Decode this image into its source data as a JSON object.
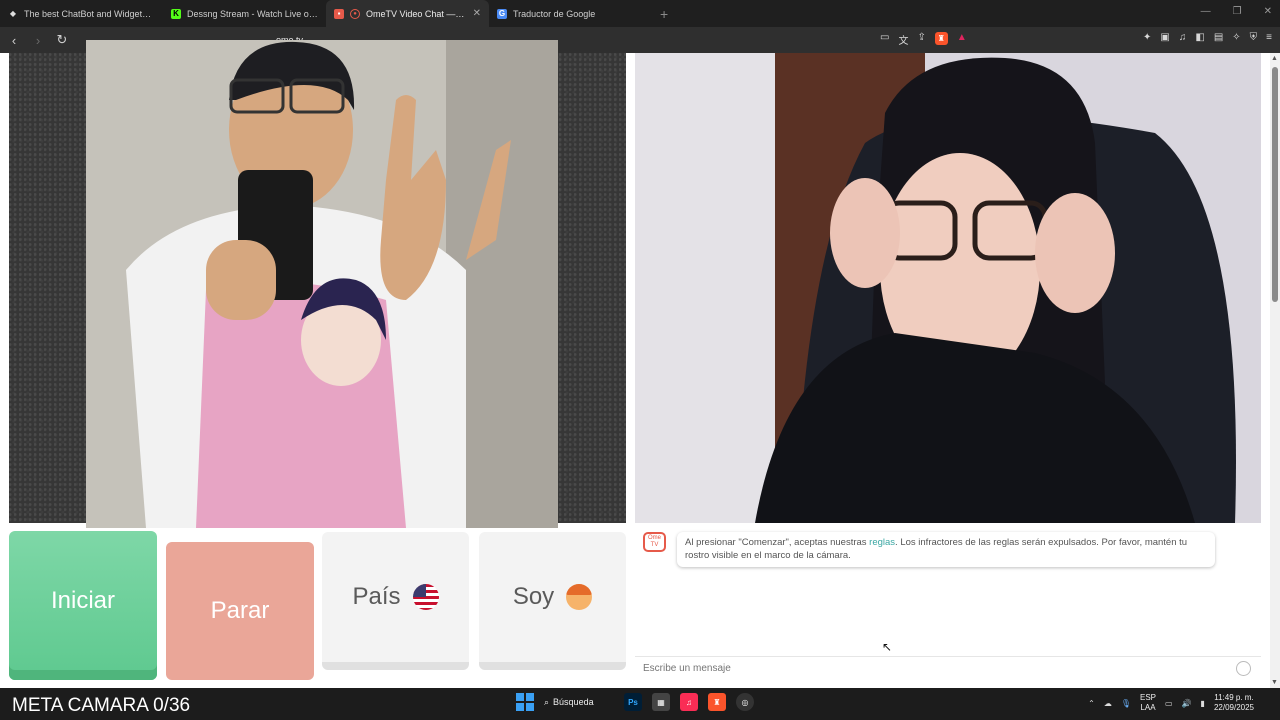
{
  "tabs": [
    {
      "title": "The best ChatBot and Widgets for Ki",
      "active": false,
      "icon": "diamond-icon"
    },
    {
      "title": "Dessng Stream - Watch Live on Kick",
      "active": false,
      "icon": "kick-icon"
    },
    {
      "title": "OmeTV Video Chat — Omeg",
      "active": true,
      "icon": "ometv-icon"
    },
    {
      "title": "Traductor de Google",
      "active": false,
      "icon": "translate-icon"
    }
  ],
  "toolbar": {
    "url": "ome.tv"
  },
  "controls": {
    "start_label": "Iniciar",
    "stop_label": "Parar",
    "country_label": "País",
    "gender_label": "Soy"
  },
  "chat": {
    "logo_text": "Ome TV",
    "notice_before": "Al presionar \"Comenzar\", aceptas nuestras",
    "notice_link": "reglas",
    "notice_after": ". Los infractores de las reglas serán expulsados. Por favor, mantén tu rostro visible en el marco de la cámara.",
    "placeholder": "Escribe un mensaje"
  },
  "overlay_text": "META CAMARA 0/36",
  "taskbar": {
    "search_label": "Búsqueda",
    "lang_top": "ESP",
    "lang_bottom": "LAA",
    "time": "11:49 p. m.",
    "date": "22/09/2025"
  },
  "colors": {
    "start": "#6fd19c",
    "stop": "#eaa698",
    "link": "#3aa7a3"
  }
}
